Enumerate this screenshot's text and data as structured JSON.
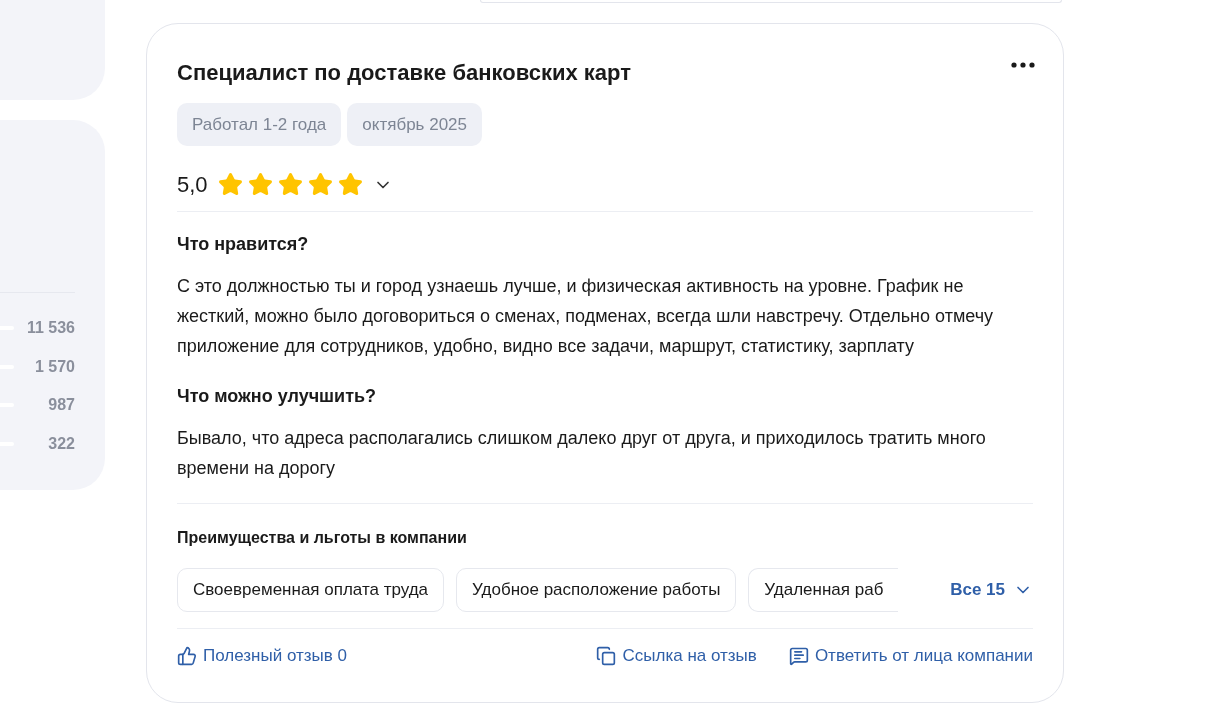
{
  "rating_counts": [
    {
      "count": "11 536"
    },
    {
      "count": "1 570"
    },
    {
      "count": "987"
    },
    {
      "count": "322"
    }
  ],
  "review": {
    "title": "Специалист по доставке банковских карт",
    "tags": [
      "Работал 1-2 года",
      "октябрь 2025"
    ],
    "score": "5,0",
    "stars": 5,
    "sections": [
      {
        "heading": "Что нравится?",
        "text": "С это должностью ты и город узнаешь лучше, и физическая активность на уровне. График не жесткий, можно было договориться о сменах, подменах, всегда шли навстречу. Отдельно отмечу приложение для сотрудников, удобно, видно все задачи, маршрут, статистику, зарплату"
      },
      {
        "heading": "Что можно улучшить?",
        "text": "Бывало, что адреса располагались слишком далеко друг от друга, и приходилось тратить много времени на дорогу"
      }
    ],
    "benefits_title": "Преимущества и льготы в компании",
    "benefits": [
      "Своевременная оплата труда",
      "Удобное расположение работы",
      "Удаленная раб"
    ],
    "benefits_more": "Все 15",
    "actions": [
      {
        "kind": "like",
        "label": "Полезный отзыв 0"
      },
      {
        "kind": "link",
        "label": "Ссылка на отзыв"
      },
      {
        "kind": "reply",
        "label": "Ответить от лица компании"
      }
    ]
  }
}
